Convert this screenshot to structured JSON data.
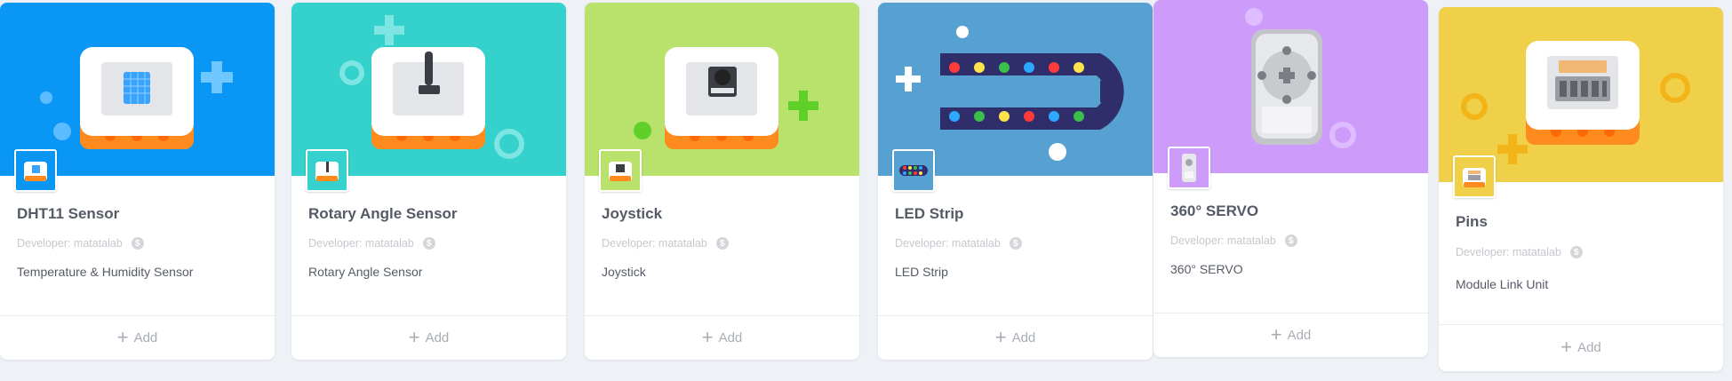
{
  "cards": [
    {
      "title": "DHT11 Sensor",
      "developer": "Developer: matatalab",
      "description": "Temperature & Humidity Sensor",
      "add_label": "Add",
      "color": "#0996f5"
    },
    {
      "title": "Rotary Angle Sensor",
      "developer": "Developer: matatalab",
      "description": "Rotary Angle Sensor",
      "add_label": "Add",
      "color": "#35d1cc"
    },
    {
      "title": "Joystick",
      "developer": "Developer: matatalab",
      "description": "Joystick",
      "add_label": "Add",
      "color": "#b8e26c"
    },
    {
      "title": "LED Strip",
      "developer": "Developer: matatalab",
      "description": "LED Strip",
      "add_label": "Add",
      "color": "#57a0d2"
    },
    {
      "title": "360° SERVO",
      "developer": "Developer: matatalab",
      "description": "360° SERVO",
      "add_label": "Add",
      "color": "#cd9cfb"
    },
    {
      "title": "Pins",
      "developer": "Developer: matatalab",
      "description": "Module Link Unit",
      "add_label": "Add",
      "color": "#efd048"
    }
  ]
}
